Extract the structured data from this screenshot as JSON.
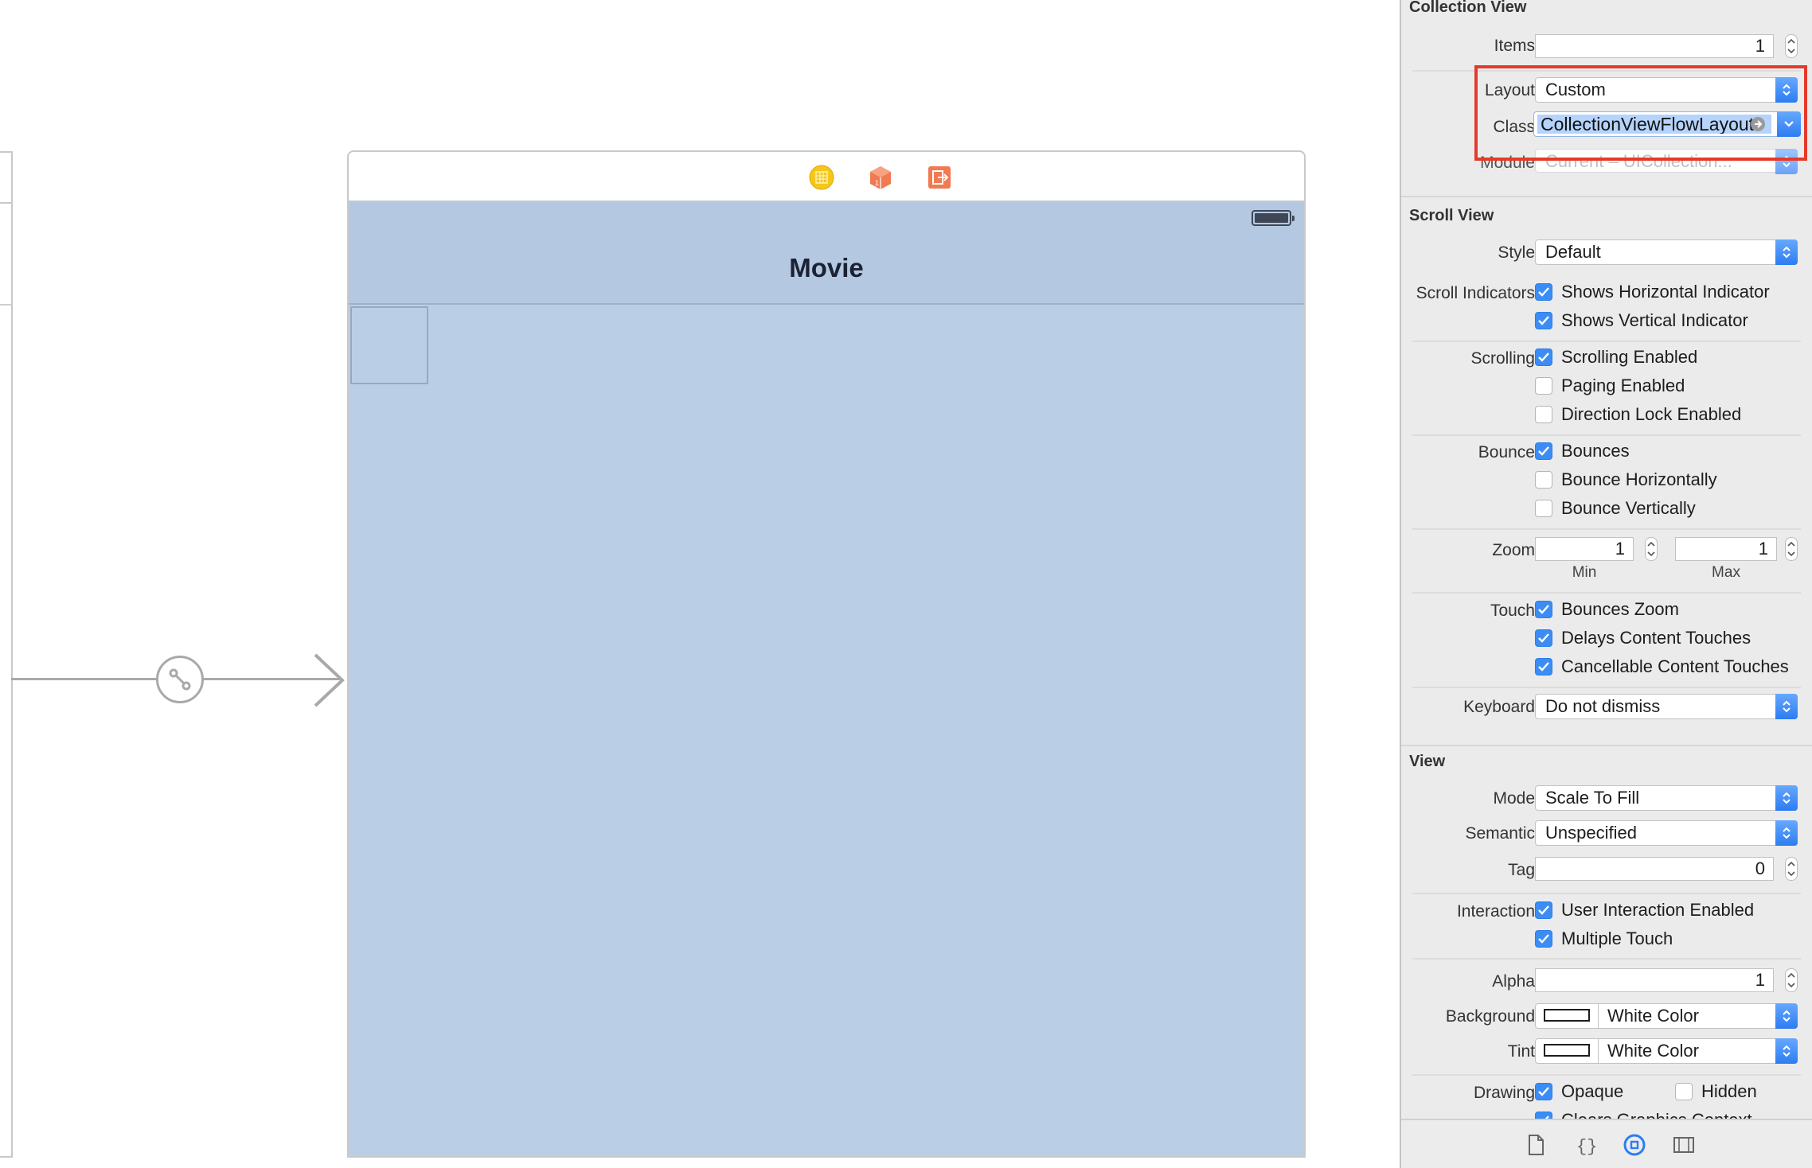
{
  "storyboard": {
    "scene_title": "Movie"
  },
  "inspector": {
    "collection_view": {
      "section_title": "Collection View",
      "items_label": "Items",
      "items_value": "1",
      "layout_label": "Layout",
      "layout_value": "Custom",
      "class_label": "Class",
      "class_value": "CollectionViewFlowLayout",
      "module_label": "Module",
      "module_placeholder": "Current – UICollection..."
    },
    "scroll_view": {
      "section_title": "Scroll View",
      "style_label": "Style",
      "style_value": "Default",
      "indicators_label": "Scroll Indicators",
      "shows_horizontal": {
        "label": "Shows Horizontal Indicator",
        "checked": true
      },
      "shows_vertical": {
        "label": "Shows Vertical Indicator",
        "checked": true
      },
      "scrolling_label": "Scrolling",
      "scrolling_enabled": {
        "label": "Scrolling Enabled",
        "checked": true
      },
      "paging_enabled": {
        "label": "Paging Enabled",
        "checked": false
      },
      "direction_lock": {
        "label": "Direction Lock Enabled",
        "checked": false
      },
      "bounce_label": "Bounce",
      "bounces": {
        "label": "Bounces",
        "checked": true
      },
      "bounce_horizontally": {
        "label": "Bounce Horizontally",
        "checked": false
      },
      "bounce_vertically": {
        "label": "Bounce Vertically",
        "checked": false
      },
      "zoom_label": "Zoom",
      "zoom_min": "1",
      "zoom_max": "1",
      "min_caption": "Min",
      "max_caption": "Max",
      "touch_label": "Touch",
      "bounces_zoom": {
        "label": "Bounces Zoom",
        "checked": true
      },
      "delays_content_touches": {
        "label": "Delays Content Touches",
        "checked": true
      },
      "cancellable_content_touches": {
        "label": "Cancellable Content Touches",
        "checked": true
      },
      "keyboard_label": "Keyboard",
      "keyboard_value": "Do not dismiss"
    },
    "view": {
      "section_title": "View",
      "mode_label": "Mode",
      "mode_value": "Scale To Fill",
      "semantic_label": "Semantic",
      "semantic_value": "Unspecified",
      "tag_label": "Tag",
      "tag_value": "0",
      "interaction_label": "Interaction",
      "user_interaction": {
        "label": "User Interaction Enabled",
        "checked": true
      },
      "multiple_touch": {
        "label": "Multiple Touch",
        "checked": true
      },
      "alpha_label": "Alpha",
      "alpha_value": "1",
      "background_label": "Background",
      "background_value": "White Color",
      "tint_label": "Tint",
      "tint_value": "White Color",
      "drawing_label": "Drawing",
      "opaque": {
        "label": "Opaque",
        "checked": true
      },
      "hidden": {
        "label": "Hidden",
        "checked": false
      },
      "clears_graphics": {
        "label": "Clears Graphics Context",
        "checked": true
      }
    },
    "bottom_tabs": [
      "file-inspector-icon",
      "quick-help-icon",
      "attributes-inspector-icon",
      "size-inspector-icon"
    ]
  },
  "colors": {
    "accent": "#3b8df5",
    "highlight": "#e43a2b",
    "nav_bar": "#b4c8e1",
    "view_background": "#bacfe6"
  }
}
